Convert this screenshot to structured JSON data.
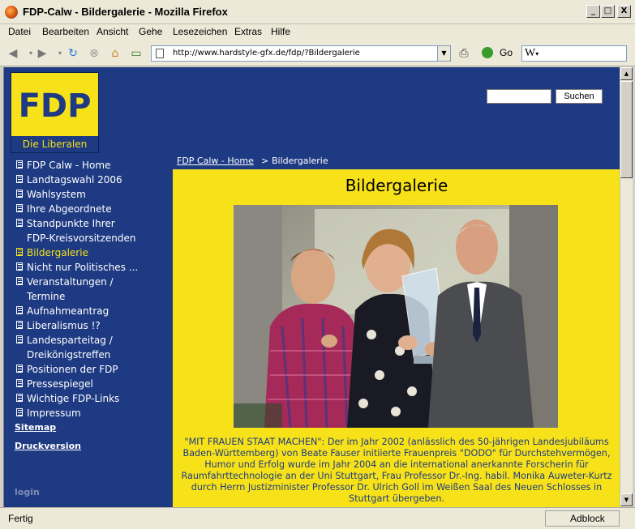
{
  "window": {
    "title": "FDP-Calw - Bildergalerie - Mozilla Firefox",
    "controls": {
      "minimize": "_",
      "maximize": "□",
      "close": "X"
    }
  },
  "menu": {
    "items": [
      "Datei",
      "Bearbeiten",
      "Ansicht",
      "Gehe",
      "Lesezeichen",
      "Extras",
      "Hilfe"
    ]
  },
  "toolbar": {
    "url": "http://www.hardstyle-gfx.de/fdp/?Bildergalerie",
    "go_label": "Go",
    "search_engine_glyph": "W"
  },
  "header": {
    "logo_text": "FDP",
    "logo_subtitle": "Die Liberalen",
    "search_placeholder": "",
    "search_button": "Suchen"
  },
  "sidebar": {
    "items": [
      {
        "label": "FDP Calw - Home",
        "active": false
      },
      {
        "label": "Landtagswahl 2006",
        "active": false
      },
      {
        "label": "Wahlsystem",
        "active": false
      },
      {
        "label": "Ihre Abgeordnete",
        "active": false
      },
      {
        "label": "Standpunkte Ihrer",
        "label2": "FDP-Kreisvorsitzenden",
        "active": false
      },
      {
        "label": "Bildergalerie",
        "active": true
      },
      {
        "label": "Nicht nur Politisches ...",
        "active": false
      },
      {
        "label": "Veranstaltungen /",
        "label2": "Termine",
        "active": false
      },
      {
        "label": "Aufnahmeantrag",
        "active": false
      },
      {
        "label": "Liberalismus !?",
        "active": false
      },
      {
        "label": "Landesparteitag /",
        "label2": "Dreikönigstreffen",
        "active": false
      },
      {
        "label": "Positionen der FDP",
        "active": false
      },
      {
        "label": "Pressespiegel",
        "active": false
      },
      {
        "label": "Wichtige FDP-Links",
        "active": false
      },
      {
        "label": "Impressum",
        "active": false
      }
    ],
    "sitemap": "Sitemap",
    "print": "Druckversion",
    "login": "login"
  },
  "content": {
    "breadcrumb_home": "FDP Calw - Home",
    "breadcrumb_sep": ">",
    "breadcrumb_current": "Bildergalerie",
    "title": "Bildergalerie",
    "caption": "\"MIT FRAUEN STAAT MACHEN\": Der im Jahr 2002 (anlässlich des 50-jährigen Landesjubiläums Baden-Württemberg) von Beate Fauser initiierte Frauenpreis \"DODO\" für Durchstehvermögen, Humor und Erfolg wurde im Jahr 2004 an die international anerkannte Forscherin für Raumfahrttechnologie an der Uni Stuttgart, Frau Professor Dr.-Ing. habil. Monika Auweter-Kurtz durch Herrn Justizminister Professor Dr. Ulrich Goll im Weißen Saal des Neuen Schlosses in Stuttgart übergeben."
  },
  "status": {
    "text": "Fertig",
    "adblock": "Adblock"
  }
}
